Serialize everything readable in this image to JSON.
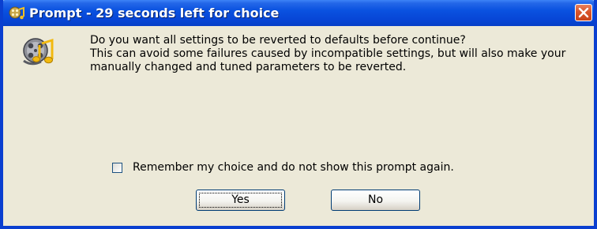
{
  "window": {
    "title": "Prompt - 29 seconds left for choice",
    "title_icon": "app-icon",
    "close_icon": "close-icon",
    "colors": {
      "titlebar": "#0a52e0",
      "body": "#ece9d8",
      "close_button": "#d9552a"
    }
  },
  "message": {
    "icon": "film-music-icon",
    "question": "Do you want all settings to be reverted to defaults before continue?",
    "detail": "This can avoid some failures caused by incompatible settings, but will also make your manually changed and tuned parameters to be reverted."
  },
  "remember": {
    "checked": false,
    "label": "Remember my choice and do not show this prompt again."
  },
  "buttons": {
    "yes_label": "Yes",
    "no_label": "No",
    "default": "Yes"
  }
}
